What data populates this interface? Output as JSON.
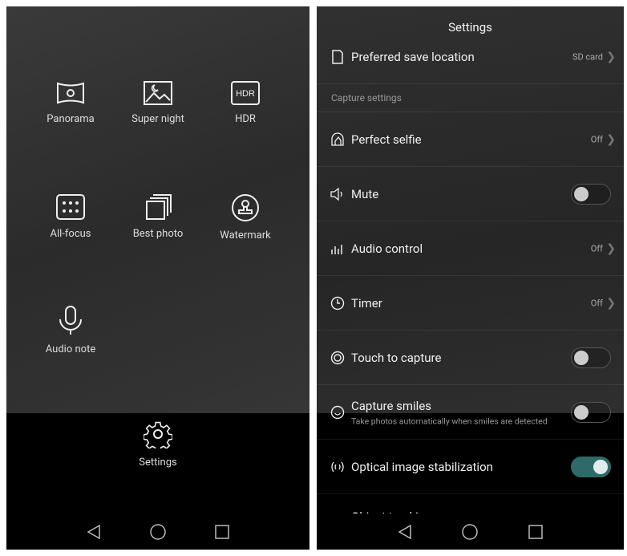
{
  "left": {
    "modes": [
      {
        "label": "Panorama",
        "icon": "panorama-icon"
      },
      {
        "label": "Super night",
        "icon": "super-night-icon"
      },
      {
        "label": "HDR",
        "icon": "hdr-icon",
        "icon_text": "HDR"
      },
      {
        "label": "All-focus",
        "icon": "all-focus-icon"
      },
      {
        "label": "Best photo",
        "icon": "best-photo-icon"
      },
      {
        "label": "Watermark",
        "icon": "watermark-icon"
      },
      {
        "label": "Audio note",
        "icon": "microphone-icon"
      }
    ],
    "settings_label": "Settings"
  },
  "right": {
    "title": "Settings",
    "rows": [
      {
        "label": "Preferred save location",
        "value": "SD card"
      },
      {
        "label": "Capture settings"
      },
      {
        "label": "Perfect selfie",
        "value": "Off"
      },
      {
        "label": "Mute",
        "toggle": false
      },
      {
        "label": "Audio control",
        "value": "Off"
      },
      {
        "label": "Timer",
        "value": "Off"
      },
      {
        "label": "Touch to capture",
        "toggle": false
      },
      {
        "label": "Capture smiles",
        "sub": "Take photos automatically when smiles are detected",
        "toggle": false
      },
      {
        "label": "Optical image stabilization",
        "toggle": true
      },
      {
        "label": "Object tracking"
      }
    ]
  },
  "colors": {
    "toggle_on": "#2e6b68"
  }
}
